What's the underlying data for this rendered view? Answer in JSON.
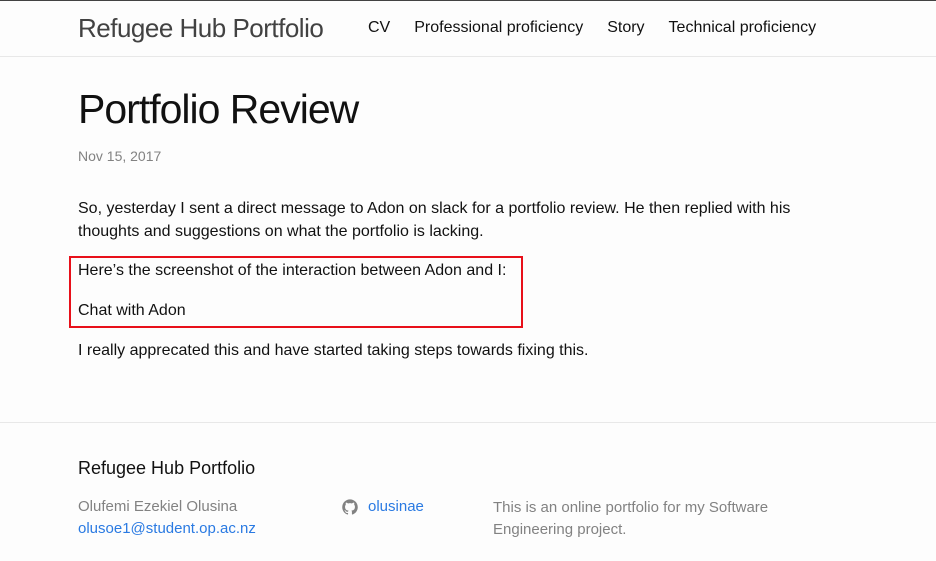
{
  "header": {
    "site_title": "Refugee Hub Portfolio",
    "nav": [
      {
        "label": "CV"
      },
      {
        "label": "Professional proficiency"
      },
      {
        "label": "Story"
      },
      {
        "label": "Technical proficiency"
      }
    ]
  },
  "post": {
    "title": "Portfolio Review",
    "date": "Nov 15, 2017",
    "paragraphs": [
      "So, yesterday I sent a direct message to Adon on slack for a portfolio review. He then replied with his thoughts and suggestions on what the portfolio is lacking.",
      "Here’s the screenshot of the interaction between Adon and I:",
      "Chat with Adon",
      "I really apprecated this and have started taking steps towards fixing this."
    ]
  },
  "annotation": {
    "box_color": "#e8101a"
  },
  "footer": {
    "heading": "Refugee Hub Portfolio",
    "author_name": "Olufemi Ezekiel Olusina",
    "email": "olusoe1@student.op.ac.nz",
    "github_icon": "github-icon",
    "github_user": "olusinae",
    "description": "This is an online portfolio for my Software Engineering project."
  },
  "colors": {
    "link": "#2a7ae2",
    "muted": "#828282",
    "text": "#111111"
  }
}
